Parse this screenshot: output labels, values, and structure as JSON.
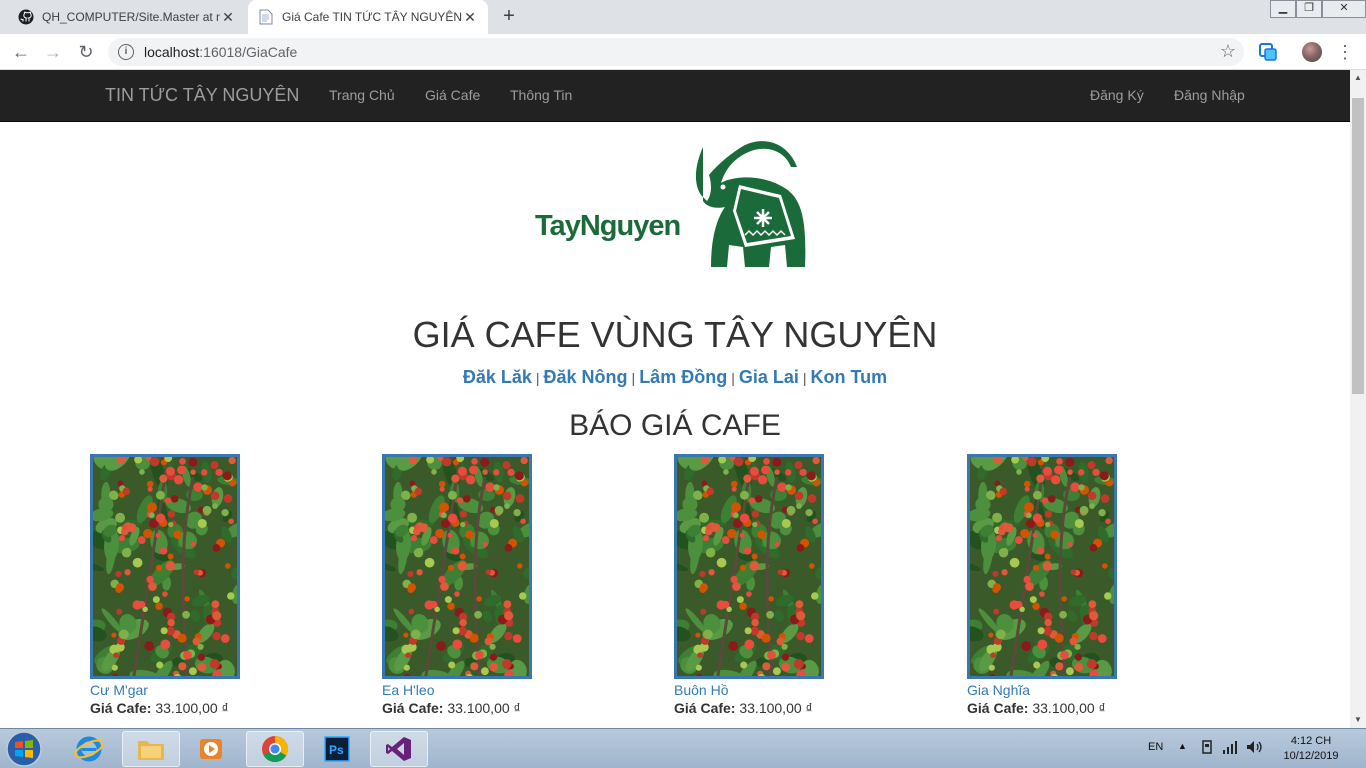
{
  "browser": {
    "tabs": [
      {
        "title": "QH_COMPUTER/Site.Master at m",
        "icon": "github-icon",
        "active": false
      },
      {
        "title": "Giá Cafe TIN TỨC TÂY NGUYÊN",
        "icon": "page-icon",
        "active": true
      }
    ],
    "new_tab_symbol": "+",
    "close_symbol": "✕",
    "address": {
      "host": "localhost",
      "path": ":16018/GiaCafe"
    }
  },
  "site": {
    "brand": "TIN TỨC TÂY NGUYÊN",
    "nav_left": [
      "Trang Chủ",
      "Giá Cafe",
      "Thông Tin"
    ],
    "nav_right": [
      "Đăng Ký",
      "Đăng Nhập"
    ],
    "logo_text": "TayNguyen",
    "heading": "GIÁ CAFE VÙNG TÂY NGUYÊN",
    "regions": [
      "Đăk Lăk",
      "Đăk Nông",
      "Lâm Đồng",
      "Gia Lai",
      "Kon Tum"
    ],
    "region_separator": "|",
    "subheading": "BÁO GIÁ CAFE",
    "price_label": "Giá Cafe:",
    "products": [
      {
        "name": "Cư M'gar",
        "price": "33.100,00 ₫"
      },
      {
        "name": "Ea H'leo",
        "price": "33.100,00 ₫"
      },
      {
        "name": "Buôn Hồ",
        "price": "33.100,00 ₫"
      },
      {
        "name": "Gia Nghĩa",
        "price": "33.100,00 ₫"
      }
    ]
  },
  "taskbar": {
    "language": "EN",
    "time": "4:12 CH",
    "date": "10/12/2019"
  },
  "colors": {
    "navbar_bg": "#222222",
    "link": "#337ab7",
    "logo_green": "#1b6b3a"
  }
}
